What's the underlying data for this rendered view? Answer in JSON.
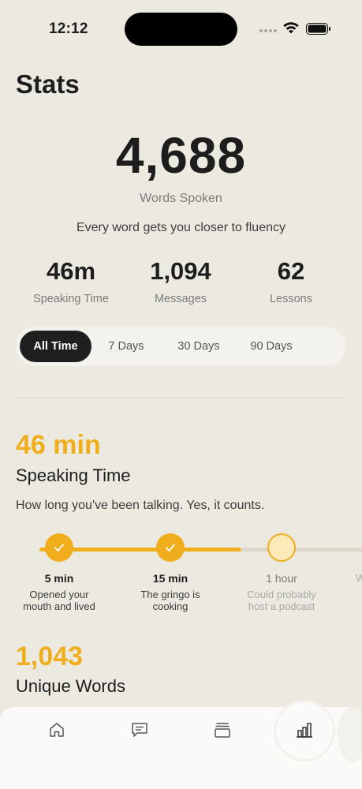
{
  "status_bar": {
    "time": "12:12"
  },
  "page": {
    "title": "Stats"
  },
  "hero": {
    "value": "4,688",
    "label": "Words Spoken",
    "tagline": "Every word gets you closer to fluency"
  },
  "stats": [
    {
      "value": "46m",
      "label": "Speaking Time"
    },
    {
      "value": "1,094",
      "label": "Messages"
    },
    {
      "value": "62",
      "label": "Lessons"
    }
  ],
  "range_tabs": [
    {
      "label": "All Time",
      "selected": true
    },
    {
      "label": "7 Days",
      "selected": false
    },
    {
      "label": "30 Days",
      "selected": false
    },
    {
      "label": "90 Days",
      "selected": false
    }
  ],
  "speaking_section": {
    "value": "46 min",
    "title": "Speaking Time",
    "description": "How long you've been talking. Yes, it counts.",
    "milestones": [
      {
        "title": "5 min",
        "desc_line1": "Opened your",
        "desc_line2": "mouth and lived",
        "achieved": true
      },
      {
        "title": "15 min",
        "desc_line1": "The gringo is",
        "desc_line2": "cooking",
        "achieved": true
      },
      {
        "title": "1 hour",
        "desc_line1": "Could probably",
        "desc_line2": "host a podcast",
        "achieved": false
      },
      {
        "title": "",
        "desc_line1": "W",
        "desc_line2": "",
        "achieved": false
      }
    ]
  },
  "unique_words_section": {
    "value": "1,043",
    "title": "Unique Words"
  },
  "tab_bar": {
    "items": [
      {
        "icon": "home-icon"
      },
      {
        "icon": "chat-icon"
      },
      {
        "icon": "lessons-stack-icon"
      },
      {
        "icon": "stats-chart-icon",
        "active": true
      }
    ]
  },
  "colors": {
    "background": "#ECE9E0",
    "accent": "#F0AE1C",
    "text": "#1D1D1D",
    "muted": "#7B7B7B",
    "active_tab": "#1F1F1F"
  }
}
